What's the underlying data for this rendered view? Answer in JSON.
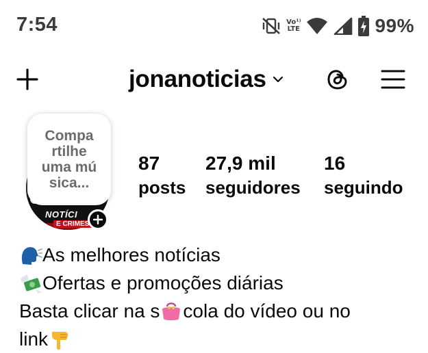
{
  "status_bar": {
    "time": "7:54",
    "volte_top": "Vo¹⁾",
    "volte_bottom": "LTE",
    "battery_percent": "99%",
    "icons": [
      "mute-vibrate-icon",
      "volte-icon",
      "wifi-icon",
      "signal-icon",
      "battery-charging-icon"
    ]
  },
  "header": {
    "username": "jonanoticias",
    "icons": [
      "add-icon",
      "chevron-down-icon",
      "threads-icon",
      "menu-icon"
    ]
  },
  "profile": {
    "note_text": "Compa rtilhe uma mú sica...",
    "avatar_text_1": "NOTÍCI",
    "avatar_text_2": "E CRIMES",
    "stats": [
      {
        "value": "87",
        "label": "posts"
      },
      {
        "value": "27,9 mil",
        "label": "seguidores"
      },
      {
        "value": "16",
        "label": "seguindo"
      }
    ]
  },
  "bio": {
    "line1": "As melhores notícias",
    "line2": "Ofertas e promoções diárias",
    "line3_a": " Basta clicar na s",
    "line3_b": "cola do vídeo ou no",
    "line4": "link",
    "emojis": [
      "speaking-head-emoji",
      "money-with-wings-emoji",
      "purse-emoji",
      "pointing-down-emoji"
    ]
  },
  "colors": {
    "text": "#0a0a0a",
    "status_text": "#3b3b3b",
    "note_text": "#6b6b6b",
    "background": "#ffffff"
  }
}
